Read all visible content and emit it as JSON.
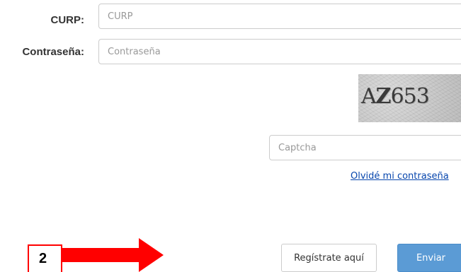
{
  "form": {
    "curp": {
      "label": "CURP:",
      "placeholder": "CURP"
    },
    "password": {
      "label": "Contraseña:",
      "placeholder": "Contraseña"
    },
    "captcha": {
      "image_text_prefix": "A",
      "image_text_bold": "Z",
      "image_text_suffix": "653",
      "placeholder": "Captcha"
    },
    "forgot_link": "Olvidé mi contraseña",
    "register_button": "Regístrate aquí",
    "submit_button": "Enviar"
  },
  "annotation": {
    "step_number": "2",
    "color": "#ff0000"
  },
  "colors": {
    "submit_bg": "#5b9bd5",
    "link": "#0645ad"
  }
}
